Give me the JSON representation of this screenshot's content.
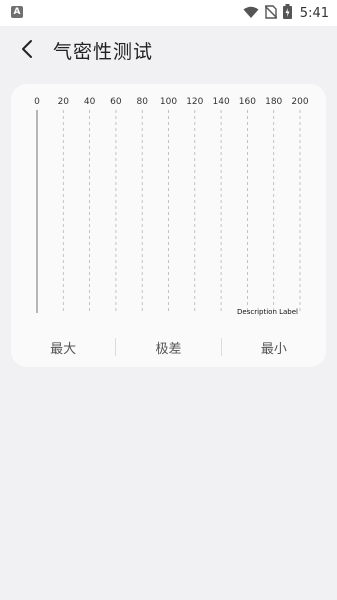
{
  "status_bar": {
    "app_icon_letter": "A",
    "time": "5:41"
  },
  "header": {
    "title": "气密性测试"
  },
  "chart": {
    "ticks": [
      "0",
      "20",
      "40",
      "60",
      "80",
      "100",
      "120",
      "140",
      "160",
      "180",
      "200"
    ],
    "description_label": "Description Label"
  },
  "chart_data": {
    "type": "bar",
    "orientation": "horizontal",
    "xlim": [
      0,
      200
    ],
    "x_ticks": [
      0,
      20,
      40,
      60,
      80,
      100,
      120,
      140,
      160,
      180,
      200
    ],
    "grid": true,
    "description": "Description Label",
    "series": []
  },
  "stats": {
    "max_label": "最大",
    "range_label": "极差",
    "min_label": "最小"
  },
  "colors": {
    "background": "#f1f1f3",
    "card": "#fafafa",
    "gridline": "#b5b5b5",
    "axis": "#999999"
  }
}
